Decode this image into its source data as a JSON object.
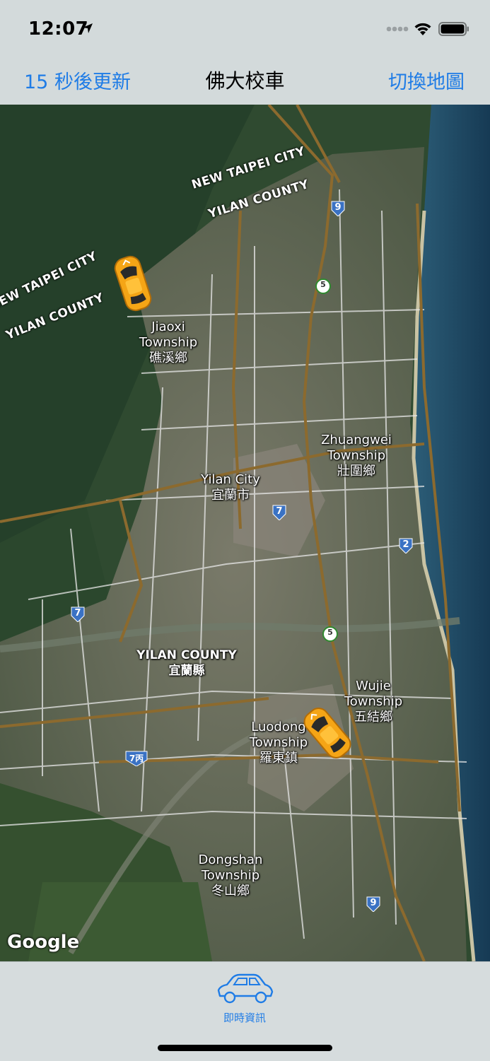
{
  "status_bar": {
    "time": "12:07"
  },
  "nav": {
    "left_label": "15 秒後更新",
    "title": "佛大校車",
    "right_label": "切換地圖"
  },
  "map": {
    "labels": {
      "jiaoxi": "Jiaoxi\nTownship\n礁溪鄉",
      "zhuangwei": "Zhuangwei\nTownship\n壯圍鄉",
      "yilan_city": "Yilan City\n宜蘭市",
      "wujie": "Wujie\nTownship\n五結鄉",
      "luodong": "Luodong\nTownship\n羅東鎮",
      "dongshan": "Dongshan\nTownship\n冬山鄉",
      "yilan_county_center": "YILAN COUNTY\n宜蘭縣"
    },
    "county_labels": {
      "new_taipei_top": "NEW TAIPEI CITY",
      "yilan_top": "YILAN COUNTY",
      "new_taipei_left": "NEW TAIPEI CITY",
      "yilan_left": "YILAN COUNTY"
    },
    "shields": {
      "s9_top": "9",
      "s5_top": "5",
      "s7_center": "7",
      "s2": "2",
      "s7_left": "7",
      "s5_bottom": "5",
      "s7b": "7丙",
      "s9_bottom": "9"
    },
    "attribution": "Google"
  },
  "tab_bar": {
    "items": [
      {
        "label": "即時資訊",
        "icon": "car-icon"
      }
    ]
  },
  "colors": {
    "accent": "#1f7ce6",
    "car_body": "#f5a516"
  }
}
